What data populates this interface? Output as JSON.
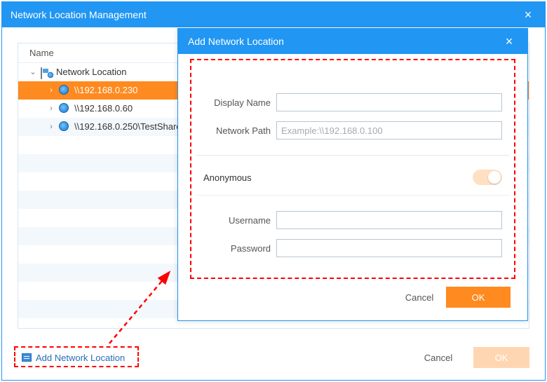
{
  "main": {
    "title": "Network Location Management",
    "tree": {
      "header": "Name",
      "root": {
        "label": "Network Location"
      },
      "items": [
        {
          "label": "\\\\192.168.0.230"
        },
        {
          "label": "\\\\192.168.0.60"
        },
        {
          "label": "\\\\192.168.0.250\\TestShare"
        }
      ]
    },
    "add_link": "Add Network Location",
    "cancel": "Cancel",
    "ok": "OK"
  },
  "modal": {
    "title": "Add Network Location",
    "display_name_label": "Display Name",
    "display_name_value": "",
    "network_path_label": "Network Path",
    "network_path_placeholder": "Example:\\\\192.168.0.100",
    "network_path_value": "",
    "anonymous_label": "Anonymous",
    "anonymous_on": true,
    "username_label": "Username",
    "username_value": "",
    "password_label": "Password",
    "password_value": "",
    "cancel": "Cancel",
    "ok": "OK"
  }
}
